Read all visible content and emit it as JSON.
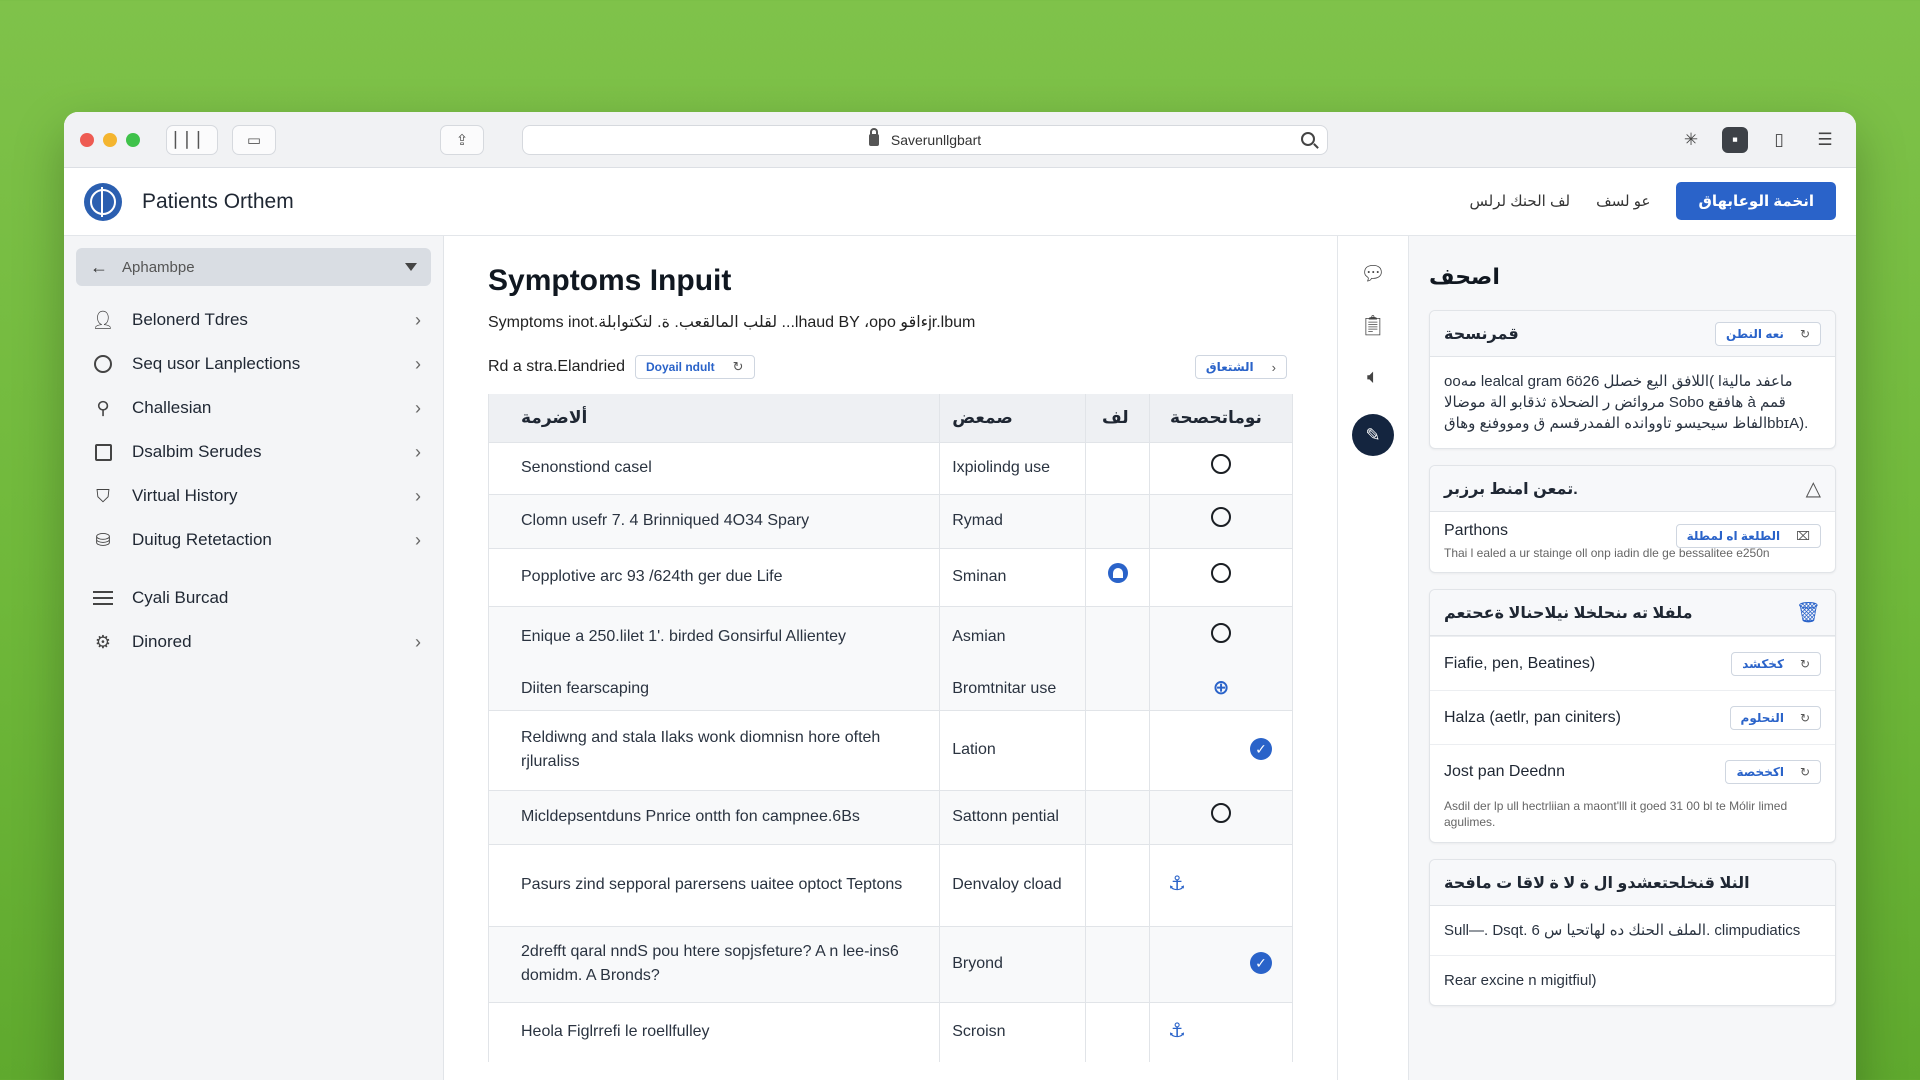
{
  "browser": {
    "address": "Saverunllgbart"
  },
  "app": {
    "title": "Patients Orthem",
    "header_links": [
      "لف الحنك لرلس",
      "عو لسف"
    ],
    "header_button": "انخمة الوعابهاق"
  },
  "sidebar": {
    "select_label": "Aphambpe",
    "items": [
      {
        "label": "Belonerd Tdres",
        "icon": "user-icon",
        "chevron": true
      },
      {
        "label": "Seq usor Lanplections",
        "icon": "circle-icon",
        "chevron": true
      },
      {
        "label": "Challesian",
        "icon": "wrench-icon",
        "chevron": true
      },
      {
        "label": "Dsalbim Serudes",
        "icon": "square-icon",
        "chevron": true
      },
      {
        "label": "Virtual History",
        "icon": "shield-icon",
        "chevron": true
      },
      {
        "label": "Duitug Retetaction",
        "icon": "person-stack-icon",
        "chevron": true
      },
      {
        "label": "Cyali Burcad",
        "icon": "menu-icon",
        "chevron": false
      },
      {
        "label": "Dinored",
        "icon": "gear-icon",
        "chevron": true
      }
    ]
  },
  "main": {
    "title": "Symptoms Inpuit",
    "subtitle": "Symptoms inot.لقلب المالقعب. ة. لتكتوابلة ...lhaud BY ،opo ءاقوjr.lbum",
    "filter_label": "Rd a stra.Elandried",
    "filter_chip": "Doyail ndult",
    "right_chip": "الشتعاق",
    "table": {
      "headers": [
        "ألاضرمة",
        "صمعض",
        "لف",
        "نوماتحصحة"
      ],
      "rows": [
        {
          "symptom": "Senonstiond casel",
          "type": "Ixpiolindg use",
          "mark3": "",
          "mark4": "radio",
          "alt": false
        },
        {
          "symptom": "Clomn usefr 7. 4 Brinniqued 4O34 Spary",
          "type": "Rymad",
          "mark3": "",
          "mark4": "radio",
          "alt": true
        },
        {
          "symptom": "Popplotive arc 93 /624th ger due Life",
          "type": "Sminan",
          "mark3": "blue",
          "mark4": "radio",
          "alt": false
        },
        {
          "symptom": "Enique a 250.lilet 1'. birded Gonsirful Allientey",
          "type": "Asmian",
          "mark3": "",
          "mark4": "radio",
          "alt": true
        },
        {
          "symptom": "Diiten fearscaping",
          "type": "Bromtnitar use",
          "mark3": "",
          "mark4": "globe",
          "alt": true
        },
        {
          "symptom": "Reldiwng and stala Ilaks wonk diomnisn hore ofteh rjluraliss",
          "type": "Lation",
          "mark3": "",
          "mark4": "check",
          "alt": false
        },
        {
          "symptom": "Micldepsentduns Pnrice ontth fon campnee.6Bs",
          "type": "Sattonn pential",
          "mark3": "",
          "mark4": "radio",
          "alt": true
        },
        {
          "symptom": "Pasurs zind sepporal parersens uaitee optoct Teptons",
          "type": "Denvaloy cload",
          "mark3": "",
          "mark4": "anchor",
          "alt": false
        },
        {
          "symptom": "2drefft qaral nndS pou htere sopjsfeture? A n lee-ins6 domidm. A Bronds?",
          "type": "Bryond",
          "mark3": "",
          "mark4": "check",
          "alt": true
        },
        {
          "symptom": "Heola Figlrrefi le roellfulley",
          "type": "Scroisn",
          "mark3": "",
          "mark4": "anchor",
          "alt": false
        }
      ]
    }
  },
  "right_panel": {
    "title": "اصحف",
    "card1": {
      "title": "قمرنسحة",
      "chip": "نعه النطن",
      "body": "ooمه lealcal ɡram 6ö26 اللافق اليع خصلل( lماعفد مالية مروائض ر الضحلاة ثذقابو الة موضالا Sobo هافقع à قمم الفاظ سيحيسو تاووانده الفمدرقسم ق ومووفنع وهاقbbɪA)."
    },
    "card2": {
      "title": "تمعن امنط برزبر.",
      "name": "Parthons",
      "chip": "الطلعة اه لمطلة",
      "desc": "Thai l ealed a ur stainge oll onp iadin dle ge bessalitee e250n"
    },
    "card3": {
      "title": "ملفلا ته ىنحلخلا نيلاحنالا ةعحتعم",
      "rows": [
        {
          "label": "Fiafie, pen, Beatines)",
          "chip": "كخكشد"
        },
        {
          "label": "Halza (aetlr, pan ciniters)",
          "chip": "النحلوم"
        },
        {
          "label": "Jost pan Deednn",
          "chip": "اكخخصة"
        }
      ],
      "note": "Asdil der lp ull hectrliian a maont'lll it goed 31 00 bl te Mólir limed agulimes."
    },
    "card4": {
      "title": "النلا قنخلحتعشدو ال ة لا ة لاقا ت مافحة",
      "rows": [
        "Sull—. Dsqt. 6 الملف الحنك ده لهاتحيا س. climpudiatics",
        "Rear excine n migitfiul)"
      ]
    }
  }
}
